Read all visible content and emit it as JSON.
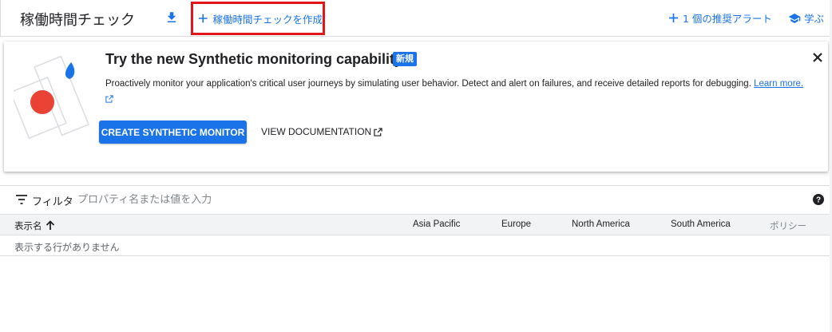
{
  "header": {
    "title": "稼働時間チェック",
    "create_label": "稼働時間チェックを作成",
    "alert_label": "1 個の推奨アラート",
    "learn_label": "学ぶ"
  },
  "banner": {
    "title": "Try the new Synthetic monitoring capability!",
    "badge": "新規",
    "description": "Proactively monitor your application's critical user journeys by simulating user behavior. Detect and alert on failures, and receive detailed reports for debugging.",
    "learn_more": "Learn more.",
    "cta_label": "CREATE SYNTHETIC MONITOR",
    "doc_label": "VIEW DOCUMENTATION"
  },
  "filter": {
    "label": "フィルタ",
    "placeholder": "プロパティ名または値を入力"
  },
  "table": {
    "columns": [
      "表示名",
      "Asia Pacific",
      "Europe",
      "North America",
      "South America",
      "ポリシー"
    ],
    "empty_text": "表示する行がありません"
  },
  "colors": {
    "accent": "#1a73e8",
    "highlight_border": "#e3141a",
    "illustration_red": "#ea4335"
  }
}
